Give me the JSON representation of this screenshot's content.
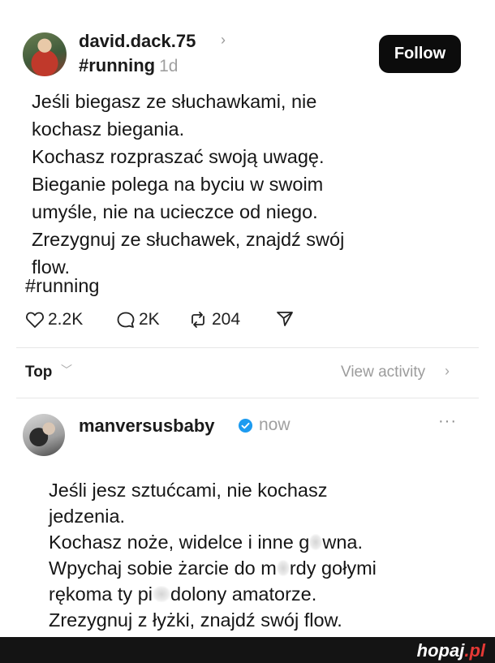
{
  "post": {
    "username": "david.dack.75",
    "chevron": "›",
    "tag": "#running",
    "time": "1d",
    "follow_label": "Follow",
    "lines": [
      "Jeśli biegasz ze słuchawkami, nie",
      "kochasz biegania.",
      "Kochasz rozpraszać swoją uwagę.",
      "Bieganie polega na byciu w swoim",
      "umyśle, nie na ucieczce od niego.",
      "Zrezygnuj ze słuchawek, znajdź swój",
      "flow."
    ],
    "hashtag": "#running",
    "likes": "2.2K",
    "comments": "2K",
    "reposts": "204"
  },
  "sort": {
    "label": "Top",
    "chevron": "﹀",
    "view_activity": "View activity",
    "view_chevron": "›"
  },
  "reply": {
    "username": "manversusbaby",
    "time": "now",
    "more": "···",
    "lines": {
      "l1": "Jeśli jesz sztućcami, nie kochasz",
      "l2": "jedzenia.",
      "l3a": "Kochasz noże, widelce i inne g",
      "l3b": "wna.",
      "l4a": "Wpychaj sobie żarcie do m",
      "l4b": "rdy gołymi",
      "l5a": "rękoma ty pi",
      "l5b": "dolony amatorze.",
      "l6": "Zrezygnuj z łyżki, znajdź swój flow."
    }
  },
  "watermark": {
    "main": "hopaj",
    "suffix": ".pl"
  },
  "colors": {
    "follow_bg": "#0c0c0c",
    "verified": "#1d9bf0",
    "brand_accent": "#e53935"
  },
  "icons": [
    "heart-icon",
    "comment-icon",
    "repost-icon",
    "share-icon",
    "verified-icon",
    "more-icon"
  ]
}
